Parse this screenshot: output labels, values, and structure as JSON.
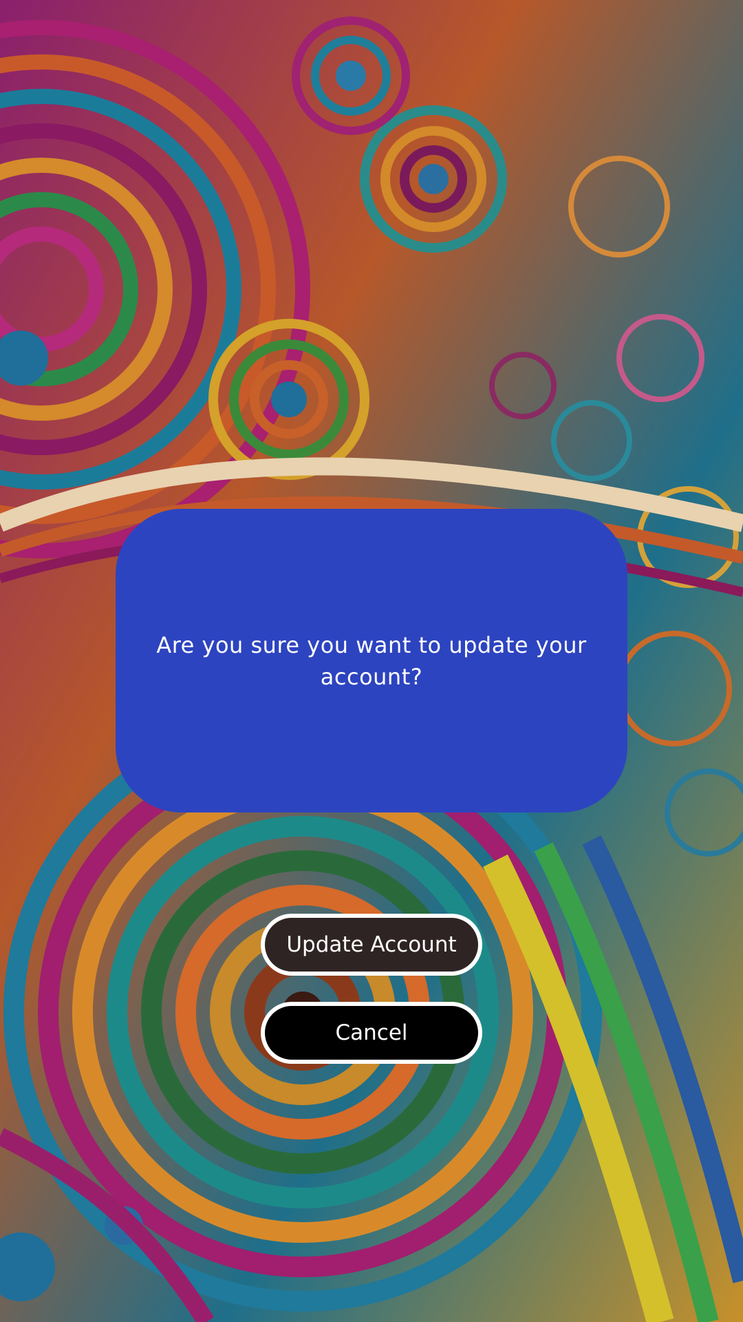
{
  "dialog": {
    "message": "Are you sure you want to update your account?"
  },
  "actions": {
    "update_label": "Update Account",
    "cancel_label": "Cancel"
  },
  "colors": {
    "dialog_background": "#2d44c0",
    "update_button_background": "#2f2424",
    "cancel_button_background": "#000000",
    "button_border": "#ffffff",
    "text": "#ffffff"
  },
  "background": {
    "description_icon": "swirl-art-wallpaper"
  }
}
